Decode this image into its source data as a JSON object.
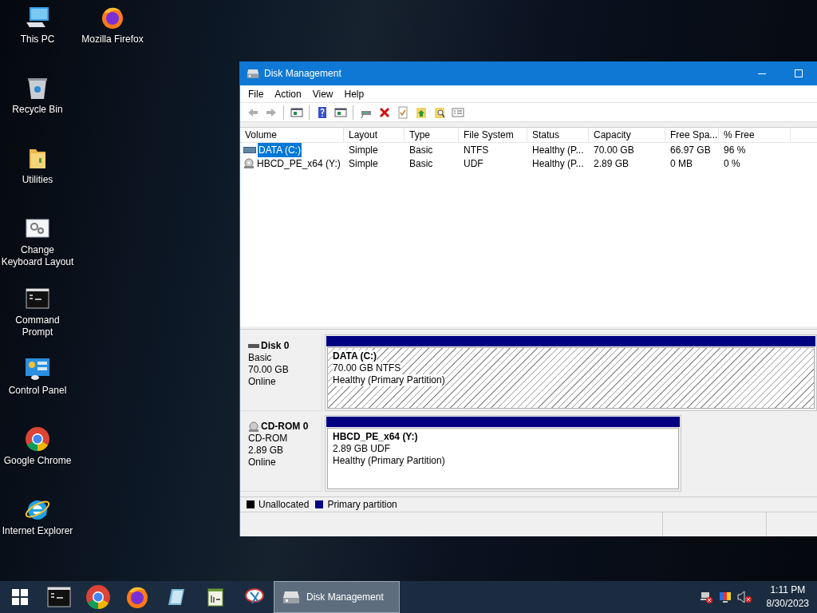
{
  "desktop_icons": [
    {
      "label": "This PC",
      "kind": "pc"
    },
    {
      "label": "Mozilla Firefox",
      "kind": "firefox"
    },
    {
      "label": "Recycle Bin",
      "kind": "recycle"
    },
    {
      "label": "Utilities",
      "kind": "folder"
    },
    {
      "label": "Change Keyboard Layout",
      "kind": "settings"
    },
    {
      "label": "Command Prompt",
      "kind": "cmd"
    },
    {
      "label": "Control Panel",
      "kind": "control"
    },
    {
      "label": "Google Chrome",
      "kind": "chrome"
    },
    {
      "label": "Internet Explorer",
      "kind": "ie"
    }
  ],
  "window": {
    "title": "Disk Management",
    "menu": [
      "File",
      "Action",
      "View",
      "Help"
    ],
    "toolbar": [
      [
        {
          "kind": "back",
          "disabled": true
        },
        {
          "kind": "forward",
          "disabled": true
        }
      ],
      [
        {
          "kind": "panel"
        }
      ],
      [
        {
          "kind": "help"
        },
        {
          "kind": "panel"
        }
      ],
      [
        {
          "kind": "drive"
        },
        {
          "kind": "delete"
        },
        {
          "kind": "check"
        },
        {
          "kind": "folder-up"
        },
        {
          "kind": "folder-search"
        },
        {
          "kind": "list"
        }
      ]
    ],
    "columns": [
      "Volume",
      "Layout",
      "Type",
      "File System",
      "Status",
      "Capacity",
      "Free Spa...",
      "% Free"
    ],
    "rows": [
      {
        "kind": "disk",
        "selected": true,
        "cells": [
          "DATA (C:)",
          "Simple",
          "Basic",
          "NTFS",
          "Healthy (P...",
          "70.00 GB",
          "66.97 GB",
          "96 %"
        ]
      },
      {
        "kind": "cd",
        "selected": false,
        "cells": [
          "HBCD_PE_x64 (Y:)",
          "Simple",
          "Basic",
          "UDF",
          "Healthy (P...",
          "2.89 GB",
          "0 MB",
          "0 %"
        ]
      }
    ],
    "disks": [
      {
        "kind": "disk",
        "name": "Disk 0",
        "type": "Basic",
        "size": "70.00 GB",
        "status": "Online",
        "partition": {
          "name": "DATA  (C:)",
          "detail": "70.00 GB NTFS",
          "status": "Healthy (Primary Partition)",
          "selected": true,
          "full": true
        }
      },
      {
        "kind": "cd",
        "name": "CD-ROM 0",
        "type": "CD-ROM",
        "size": "2.89 GB",
        "status": "Online",
        "partition": {
          "name": "HBCD_PE_x64  (Y:)",
          "detail": "2.89 GB UDF",
          "status": "Healthy (Primary Partition)",
          "selected": false,
          "full": false
        }
      }
    ],
    "legend": [
      {
        "label": "Unallocated",
        "color": "#000000"
      },
      {
        "label": "Primary partition",
        "color": "#000080"
      }
    ]
  },
  "taskbar": {
    "items": [
      {
        "kind": "start",
        "selected": false
      },
      {
        "kind": "cmd",
        "selected": false
      },
      {
        "kind": "chrome",
        "selected": false
      },
      {
        "kind": "firefox",
        "selected": false
      },
      {
        "kind": "notes",
        "selected": false
      },
      {
        "kind": "notepad",
        "selected": false
      },
      {
        "kind": "snip",
        "selected": false
      },
      {
        "kind": "diskmgmt",
        "label": "Disk Management",
        "selected": true
      }
    ],
    "tray": [
      {
        "kind": "network"
      },
      {
        "kind": "display"
      },
      {
        "kind": "volume"
      }
    ],
    "time": "1:11 PM",
    "date": "8/30/2023"
  }
}
